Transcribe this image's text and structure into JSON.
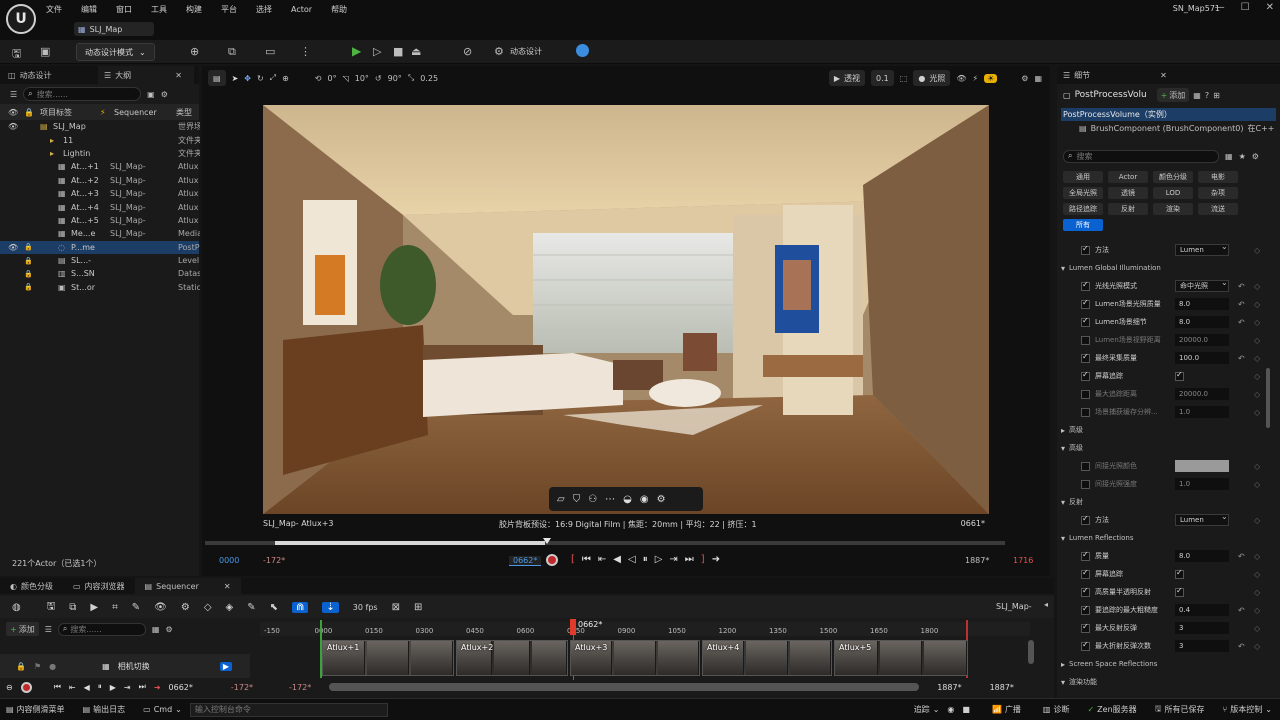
{
  "window": {
    "project": "SN_Map571",
    "map_tab": "SLJ_Map",
    "logo": "U"
  },
  "menu": [
    "文件",
    "编辑",
    "窗口",
    "工具",
    "构建",
    "平台",
    "选择",
    "Actor",
    "帮助"
  ],
  "toolbar": {
    "mode": "动态设计模式",
    "dyn": "动态设计"
  },
  "left": {
    "tab1": "动态设计",
    "tab2": "大纲",
    "search_placeholder": "搜索......",
    "hdr_label": "项目标签",
    "hdr_seq": "Sequencer",
    "hdr_type": "类型",
    "rows": [
      {
        "name": "SLJ_Map",
        "map": "",
        "type": "世界场"
      },
      {
        "name": "11",
        "map": "",
        "type": "文件夹"
      },
      {
        "name": "Lightin",
        "map": "",
        "type": "文件夹"
      },
      {
        "name": "At...+1",
        "map": "SLJ_Map-",
        "type": "Atlux"
      },
      {
        "name": "At...+2",
        "map": "SLJ_Map-",
        "type": "Atlux"
      },
      {
        "name": "At...+3",
        "map": "SLJ_Map-",
        "type": "Atlux"
      },
      {
        "name": "At...+4",
        "map": "SLJ_Map-",
        "type": "Atlux"
      },
      {
        "name": "At...+5",
        "map": "SLJ_Map-",
        "type": "Atlux"
      },
      {
        "name": "Me...e",
        "map": "SLJ_Map-",
        "type": "Media"
      },
      {
        "name": "P...me",
        "map": "",
        "type": "PostP"
      },
      {
        "name": "SL...-",
        "map": "",
        "type": "Level"
      },
      {
        "name": "S...SN",
        "map": "",
        "type": "Datas"
      },
      {
        "name": "St...or",
        "map": "",
        "type": "Static"
      }
    ],
    "count": "221个Actor（已选1个）"
  },
  "viewport": {
    "view": "透视",
    "lit": "光照",
    "snap_angle": "10°",
    "fov": "90°",
    "speed": "0.25",
    "grid": "0°",
    "zoom": "0.1",
    "camera": "SLJ_Map- Atlux+3",
    "info": "胶片背板预设：16:9 Digital Film | 焦距：20mm | 平均：22 | 挤压：1",
    "frame": "0661*",
    "start": "0000",
    "neg": "-172*",
    "current": "0662*",
    "end": "1887*",
    "end2": "1716"
  },
  "details": {
    "tab": "细节",
    "object": "PostProcessVolu",
    "add": "添加",
    "tree1": "PostProcessVolume（实例）",
    "tree2": "BrushComponent (BrushComponent0)",
    "tree2b": "在C++",
    "search": "搜索",
    "cats": [
      "通用",
      "Actor",
      "颜色分级",
      "电影",
      "全局光照",
      "透镜",
      "LOD",
      "杂项",
      "路径追踪",
      "反射",
      "渲染",
      "流送",
      "所有"
    ],
    "section_gi": "全局光照",
    "method_lbl": "方法",
    "method_val": "Lumen",
    "lumen_gi": "Lumen Global Illumination",
    "props": [
      {
        "l": "光线光照模式",
        "v": "命中光照",
        "chk": true,
        "dd": true,
        "rst": true
      },
      {
        "l": "Lumen场景光照质量",
        "v": "8.0",
        "chk": true,
        "rst": true
      },
      {
        "l": "Lumen场景细节",
        "v": "8.0",
        "chk": true,
        "rst": true
      },
      {
        "l": "Lumen场景视野距离",
        "v": "20000.0",
        "chk": false,
        "dim": true
      },
      {
        "l": "最终采集质量",
        "v": "100.0",
        "chk": true,
        "rst": true
      },
      {
        "l": "屏幕追踪",
        "v": "✓",
        "chk": true,
        "box": true
      },
      {
        "l": "最大追踪距离",
        "v": "20000.0",
        "chk": false,
        "dim": true
      },
      {
        "l": "场景捕获缓存分辨...",
        "v": "1.0",
        "chk": false,
        "dim": true
      }
    ],
    "adv": "高级",
    "adv2": "高级",
    "adv_props": [
      {
        "l": "间接光照颜色",
        "v": ""
      },
      {
        "l": "间接光照强度",
        "v": "1.0"
      }
    ],
    "refl": "反射",
    "refl_method_lbl": "方法",
    "refl_method_val": "Lumen",
    "lumen_refl": "Lumen Reflections",
    "refl_props": [
      {
        "l": "质量",
        "v": "8.0",
        "rst": true
      },
      {
        "l": "屏幕追踪",
        "v": "✓",
        "box": true
      },
      {
        "l": "高质量半透明反射",
        "v": "✓",
        "box": true
      },
      {
        "l": "要追踪的最大粗糙度",
        "v": "0.4",
        "rst": true
      },
      {
        "l": "最大反射反弹",
        "v": "3",
        "rst": false
      },
      {
        "l": "最大折射反弹次数",
        "v": "3",
        "rst": true
      }
    ],
    "ssr": "Screen Space Reflections",
    "render": "渲染功能"
  },
  "bottom": {
    "tab1": "颜色分级",
    "tab2": "内容浏览器",
    "tab3": "Sequencer",
    "fps": "30 fps",
    "map": "SLJ_Map-",
    "add": "添加",
    "search": "搜索......",
    "track": "相机切换",
    "playhead": "0662*",
    "ticks": [
      "-150",
      "0000",
      "0150",
      "0300",
      "0450",
      "0600",
      "0750",
      "0900",
      "1050",
      "1200",
      "1350",
      "1500",
      "1650",
      "1800"
    ],
    "shots": [
      "Atlux+1",
      "Atlux+2",
      "Atlux+3",
      "Atlux+4",
      "Atlux+5"
    ],
    "trans_cur": "0662*",
    "neg1": "-172*",
    "neg2": "-172*",
    "end1": "1887*",
    "end2": "1887*"
  },
  "status": {
    "drawer": "内容侧滑菜单",
    "log": "输出日志",
    "cmd": "Cmd",
    "cmd_ph": "输入控制台命令",
    "trace": "追踪",
    "broadcast": "广播",
    "diag": "诊断",
    "zen": "Zen服务器",
    "saved": "所有已保存",
    "vc": "版本控制"
  }
}
